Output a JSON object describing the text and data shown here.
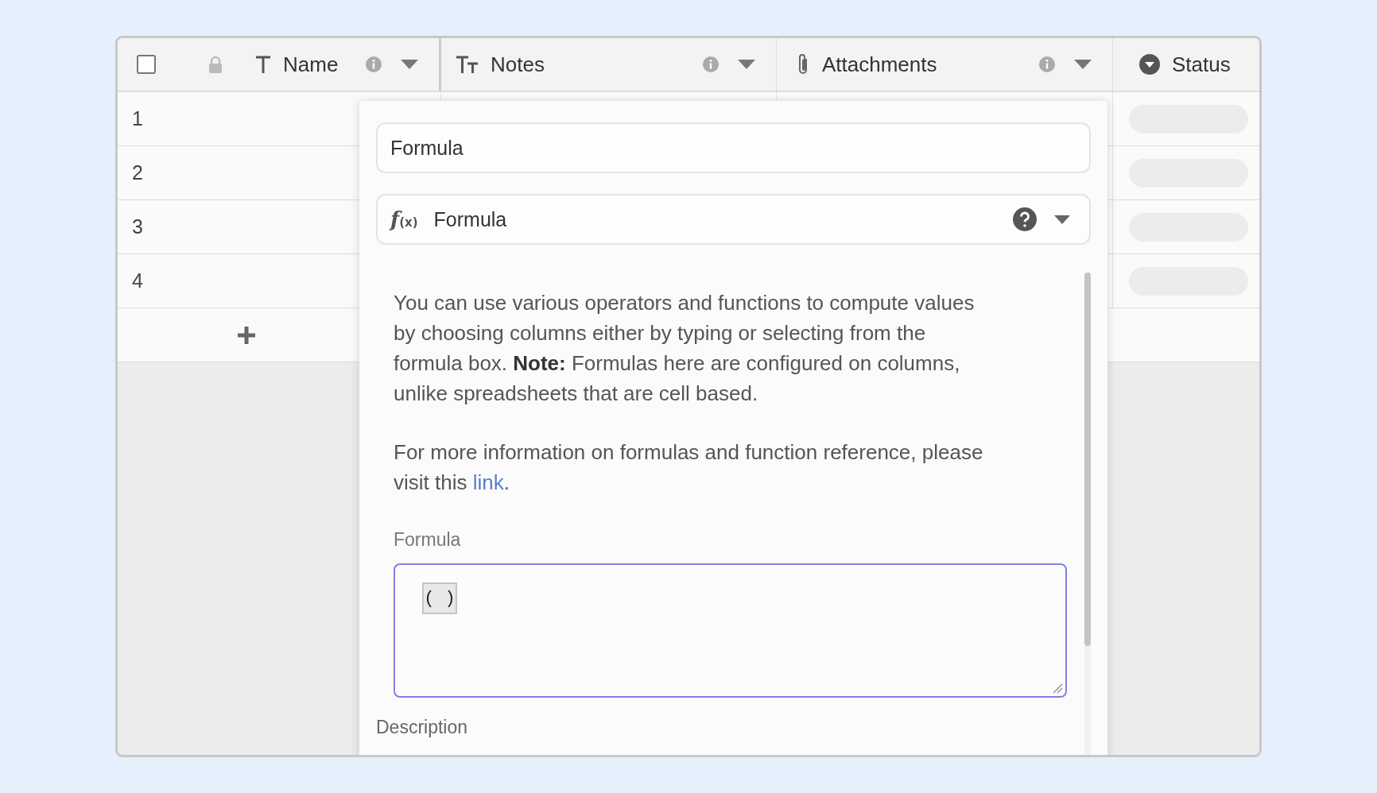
{
  "table": {
    "select_all": {
      "checked": false
    },
    "columns": [
      {
        "label": "Name",
        "kind": "text",
        "locked": true,
        "menu": true
      },
      {
        "label": "Notes",
        "kind": "long_text",
        "locked": false,
        "menu": true
      },
      {
        "label": "Attachments",
        "kind": "attachment",
        "locked": false,
        "menu": true
      },
      {
        "label": "Status",
        "kind": "single_select",
        "locked": false,
        "menu": false
      }
    ],
    "rows": [
      {
        "number": "1"
      },
      {
        "number": "2"
      },
      {
        "number": "3"
      },
      {
        "number": "4"
      }
    ]
  },
  "field_editor": {
    "name_field": {
      "value": "Formula"
    },
    "type_select": {
      "icon_main": "f",
      "icon_sub": "(x)",
      "value": "Formula"
    },
    "help": {
      "intro": "You can use various operators and functions to compute values by choosing columns either by typing or selecting from the formula box. **Note:** Formulas here are configured on columns, unlike spreadsheets that are cell based.",
      "more_before": "For more information on formulas and function reference, please visit this ",
      "more_link": "link",
      "more_after": "."
    },
    "formula_label": "Formula",
    "formula_field": {
      "token": "( )"
    },
    "description_label": "Description"
  }
}
